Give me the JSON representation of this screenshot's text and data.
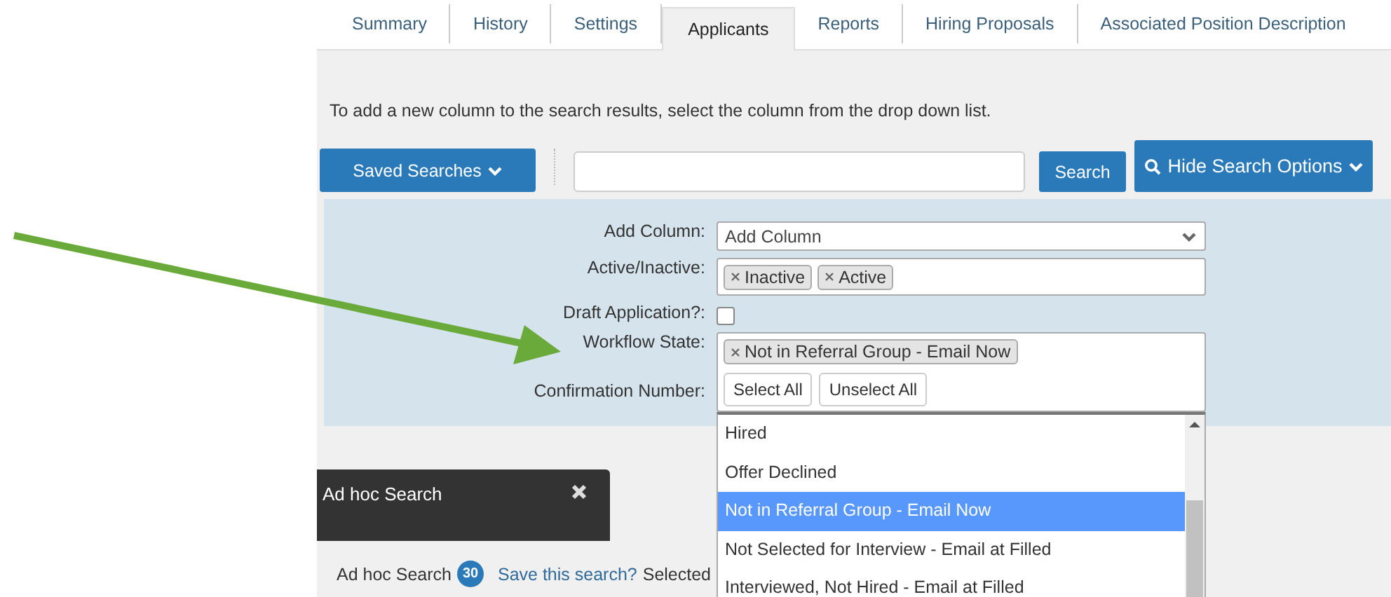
{
  "tabs": [
    {
      "label": "Summary",
      "selected": false
    },
    {
      "label": "History",
      "selected": false
    },
    {
      "label": "Settings",
      "selected": false
    },
    {
      "label": "Applicants",
      "selected": true
    },
    {
      "label": "Reports",
      "selected": false
    },
    {
      "label": "Hiring Proposals",
      "selected": false
    },
    {
      "label": "Associated Position Description",
      "selected": false
    }
  ],
  "instruction": "To add a new column to the search results, select the column from the drop down list.",
  "toolbar": {
    "saved_searches": "Saved Searches",
    "search_button": "Search",
    "hide_options_button": "Hide Search Options"
  },
  "search_options": {
    "add_column": {
      "label": "Add Column:",
      "value": "Add Column"
    },
    "active_inactive": {
      "label": "Active/Inactive:",
      "tags": [
        "Inactive",
        "Active"
      ]
    },
    "draft_application": {
      "label": "Draft Application?:",
      "checked": false
    },
    "workflow_state": {
      "label": "Workflow State:",
      "tags": [
        "Not in Referral Group - Email Now"
      ],
      "select_all": "Select All",
      "unselect_all": "Unselect All",
      "options": [
        {
          "label": "Hired",
          "selected": false
        },
        {
          "label": "Offer Declined",
          "selected": false
        },
        {
          "label": "Not in Referral Group - Email Now",
          "selected": true
        },
        {
          "label": "Not Selected for Interview - Email at Filled",
          "selected": false
        },
        {
          "label": "Interviewed, Not Hired - Email at Filled",
          "selected": false
        }
      ]
    },
    "confirmation_number": {
      "label": "Confirmation Number:"
    }
  },
  "ad_hoc_panel": {
    "title": "Ad hoc Search"
  },
  "status_line": {
    "label": "Ad hoc Search",
    "count": "30",
    "save_link": "Save this search?",
    "selected_text": "Selected"
  }
}
